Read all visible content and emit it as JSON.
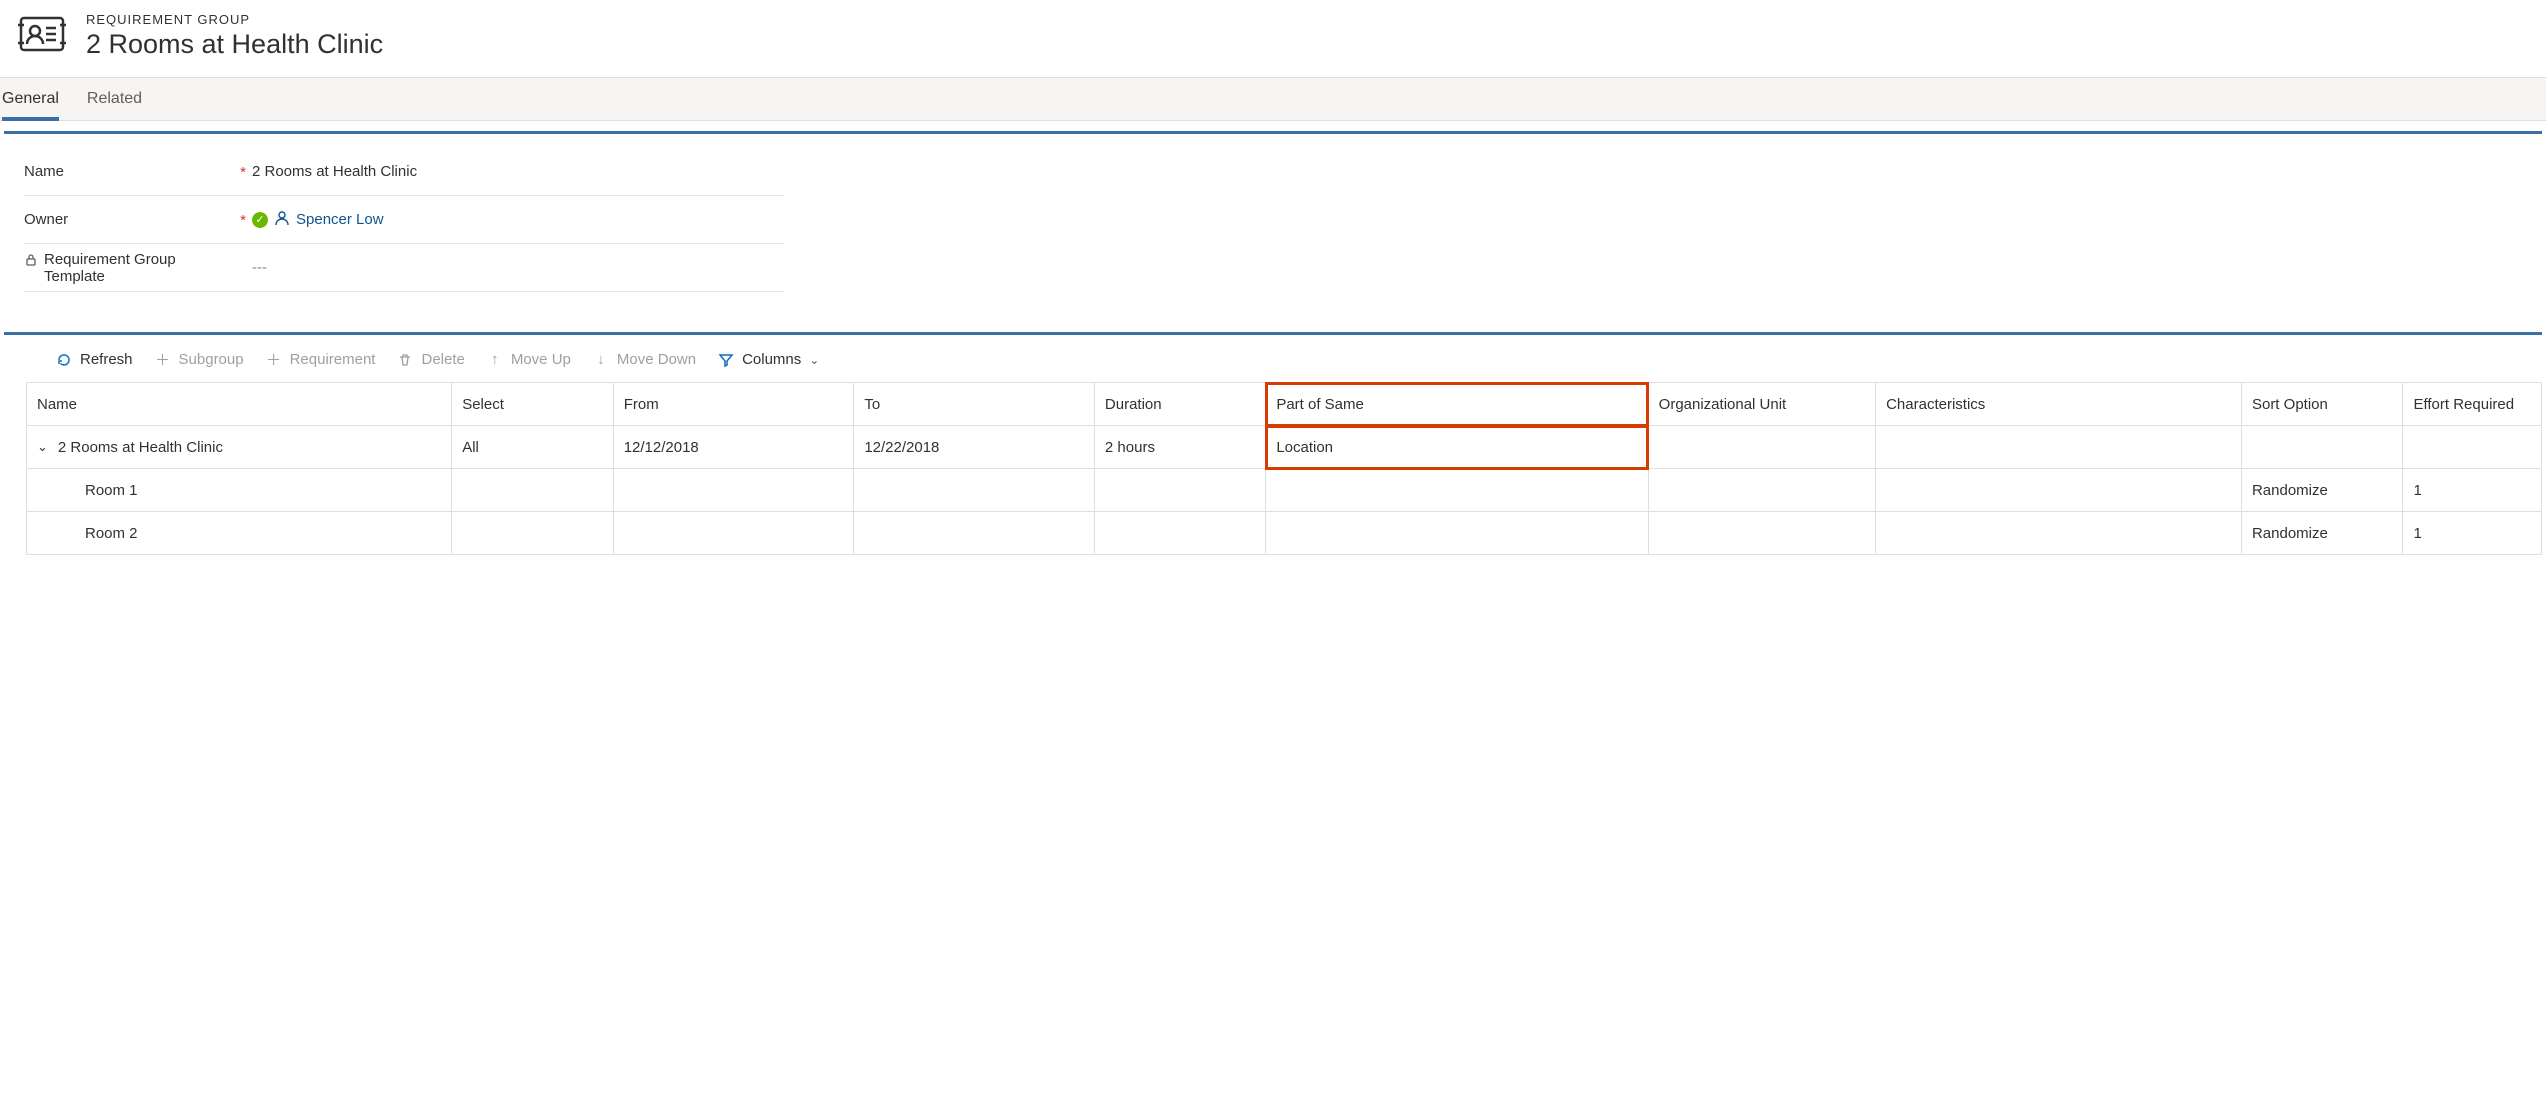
{
  "header": {
    "type_label": "REQUIREMENT GROUP",
    "title": "2 Rooms at Health Clinic"
  },
  "tabs": {
    "general": "General",
    "related": "Related"
  },
  "form": {
    "name_label": "Name",
    "name_value": "2 Rooms at Health Clinic",
    "owner_label": "Owner",
    "owner_value": "Spencer Low",
    "template_label": "Requirement Group Template",
    "template_value": "---"
  },
  "toolbar": {
    "refresh": "Refresh",
    "subgroup": "Subgroup",
    "requirement": "Requirement",
    "delete": "Delete",
    "moveup": "Move Up",
    "movedown": "Move Down",
    "columns": "Columns"
  },
  "grid": {
    "columns": {
      "name": "Name",
      "select": "Select",
      "from": "From",
      "to": "To",
      "duration": "Duration",
      "part_of_same": "Part of Same",
      "org_unit": "Organizational Unit",
      "characteristics": "Characteristics",
      "sort_option": "Sort Option",
      "effort_required": "Effort Required"
    },
    "rows": [
      {
        "name": "2 Rooms at Health Clinic",
        "select": "All",
        "from": "12/12/2018",
        "to": "12/22/2018",
        "duration": "2 hours",
        "part_of_same": "Location",
        "org_unit": "",
        "characteristics": "",
        "sort_option": "",
        "effort_required": ""
      },
      {
        "name": "Room 1",
        "select": "",
        "from": "",
        "to": "",
        "duration": "",
        "part_of_same": "",
        "org_unit": "",
        "characteristics": "",
        "sort_option": "Randomize",
        "effort_required": "1"
      },
      {
        "name": "Room 2",
        "select": "",
        "from": "",
        "to": "",
        "duration": "",
        "part_of_same": "",
        "org_unit": "",
        "characteristics": "",
        "sort_option": "Randomize",
        "effort_required": "1"
      }
    ]
  }
}
